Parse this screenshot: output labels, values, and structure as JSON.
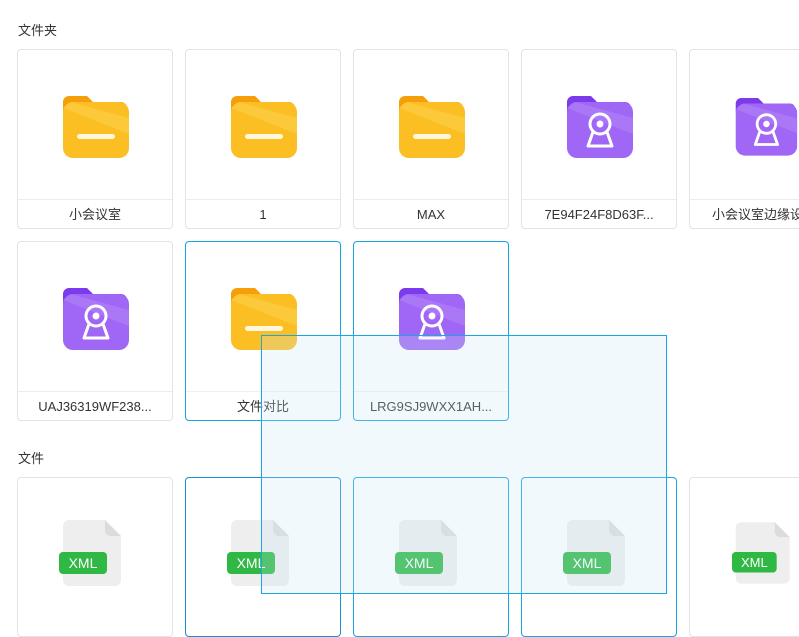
{
  "sections": {
    "folders_title": "文件夹",
    "files_title": "文件"
  },
  "folders": [
    {
      "name": "小会议室",
      "icon": "yellow-folder-icon"
    },
    {
      "name": "1",
      "icon": "yellow-folder-icon"
    },
    {
      "name": "MAX",
      "icon": "yellow-folder-icon"
    },
    {
      "name": "7E94F24F8D63F...",
      "icon": "purple-device-folder-icon"
    },
    {
      "name": "小会议室边缘设",
      "icon": "purple-device-folder-icon"
    },
    {
      "name": "UAJ36319WF238...",
      "icon": "purple-device-folder-icon"
    },
    {
      "name": "文件对比",
      "icon": "yellow-folder-icon",
      "state": "selected"
    },
    {
      "name": "LRG9SJ9WXX1AH...",
      "icon": "purple-device-folder-icon",
      "state": "selected"
    }
  ],
  "files": [
    {
      "badge": "XML",
      "icon": "xml-file-icon"
    },
    {
      "badge": "XML",
      "icon": "xml-file-icon",
      "state": "focused"
    },
    {
      "badge": "XML",
      "icon": "xml-file-icon",
      "state": "selected"
    },
    {
      "badge": "XML",
      "icon": "xml-file-icon",
      "state": "selected"
    },
    {
      "badge": "XML",
      "icon": "xml-file-icon"
    }
  ],
  "colors": {
    "folder_yellow": "#fbbf24",
    "folder_purple": "#9b5cf0",
    "xml_green": "#2fb844",
    "selection_blue": "#19a6e3"
  }
}
